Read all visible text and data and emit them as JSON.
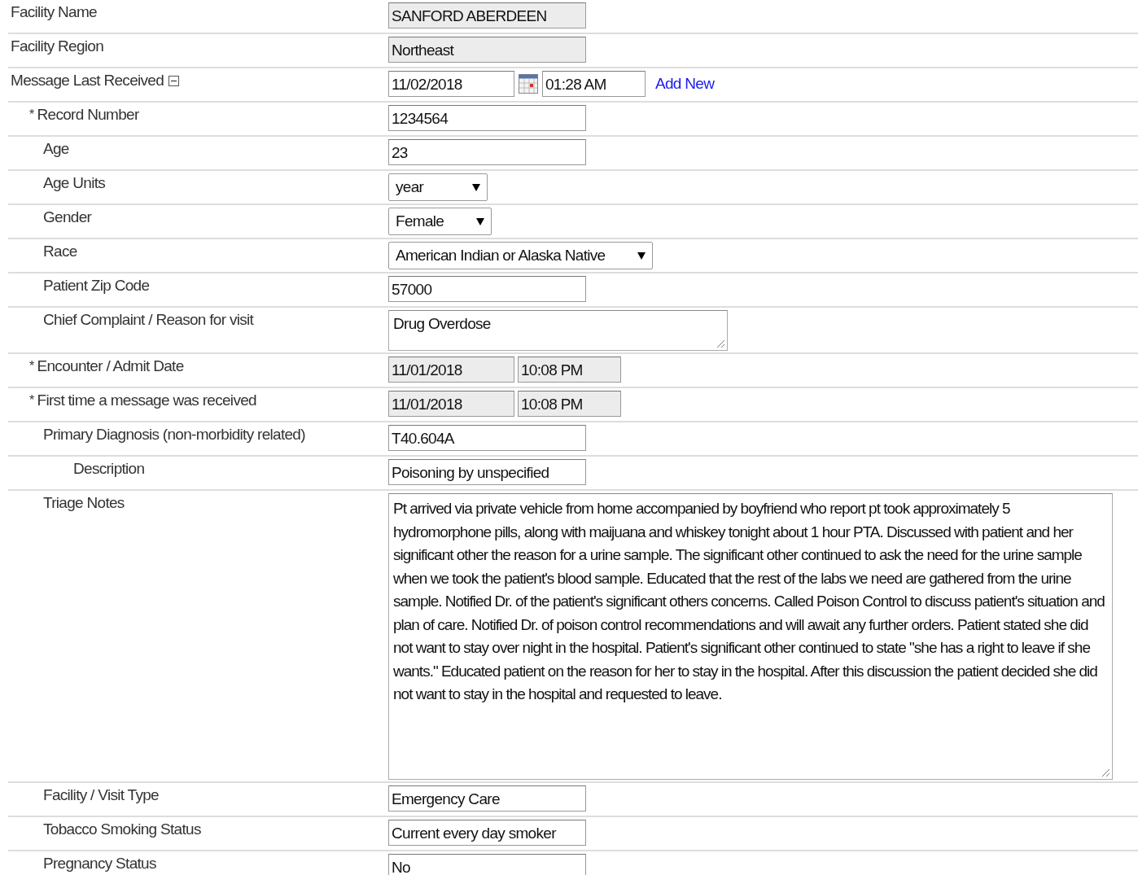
{
  "header_rows": [
    {
      "label": "Facility Name",
      "fields": [
        {
          "kind": "text",
          "value": "SANFORD ABERDEEN",
          "disabled": true
        }
      ]
    },
    {
      "label": "Facility Region",
      "fields": [
        {
          "kind": "text",
          "value": "Northeast",
          "disabled": true
        }
      ]
    },
    {
      "label": "Message Last Received",
      "expanded": true,
      "fields": [
        {
          "kind": "date",
          "value": "11/02/2018",
          "disabled": false
        },
        {
          "kind": "calendar"
        },
        {
          "kind": "time",
          "value": "01:28 AM",
          "disabled": false
        },
        {
          "kind": "link",
          "value": "Add New"
        }
      ]
    }
  ],
  "rows": [
    {
      "marker": "*",
      "label": "Record Number",
      "fields": [
        {
          "kind": "text",
          "value": "1234564",
          "disabled": false
        }
      ]
    },
    {
      "label": "Age",
      "fields": [
        {
          "kind": "text",
          "value": "23",
          "disabled": false
        }
      ]
    },
    {
      "label": "Age Units",
      "fields": [
        {
          "kind": "select",
          "value": "year"
        }
      ]
    },
    {
      "label": "Gender",
      "fields": [
        {
          "kind": "select",
          "value": "Female"
        }
      ]
    },
    {
      "label": "Race",
      "fields": [
        {
          "kind": "select",
          "value": "American Indian or Alaska Native"
        }
      ]
    },
    {
      "label": "Patient Zip Code",
      "fields": [
        {
          "kind": "text",
          "value": "57000",
          "disabled": false
        }
      ]
    },
    {
      "label": "Chief Complaint / Reason for visit",
      "fields": [
        {
          "kind": "textarea",
          "value": "Drug Overdose"
        }
      ]
    },
    {
      "marker": "*",
      "label": "Encounter / Admit Date",
      "fields": [
        {
          "kind": "date",
          "value": "11/01/2018",
          "disabled": true
        },
        {
          "kind": "time",
          "value": "10:08 PM",
          "disabled": true
        }
      ]
    },
    {
      "marker": "*",
      "label": "First time a message was received",
      "fields": [
        {
          "kind": "date",
          "value": "11/01/2018",
          "disabled": true
        },
        {
          "kind": "time",
          "value": "10:08 PM",
          "disabled": true
        }
      ]
    },
    {
      "label": "Primary Diagnosis (non-morbidity related)",
      "fields": [
        {
          "kind": "text",
          "value": "T40.604A",
          "disabled": false
        }
      ],
      "children": [
        {
          "label": "Description",
          "fields": [
            {
              "kind": "text",
              "value": "Poisoning by unspecified",
              "disabled": false
            }
          ]
        }
      ]
    },
    {
      "label": "Triage Notes",
      "fields": [
        {
          "kind": "textarea",
          "value": "Pt arrived via private vehicle from home accompanied by boyfriend who report pt took approximately 5 hydromorphone pills, along with maijuana and whiskey tonight about 1 hour PTA. Discussed with patient and her significant other the reason for a urine sample. The significant other continued to ask the need for the urine sample when we took the patient's blood sample. Educated that the rest of the labs we need are gathered from the urine sample. Notified Dr. of the patient's significant others concerns. Called Poison Control to discuss patient's situation and plan of care. Notified Dr. of poison control recommendations and will await any further orders. Patient stated she did not want to stay over night in the hospital. Patient's significant other continued to state \"she has a right to leave if she wants.\" Educated patient on the reason for her to stay in the hospital. After this discussion the patient decided she did not want to stay in the hospital and requested to leave."
        }
      ]
    },
    {
      "label": "Facility / Visit Type",
      "fields": [
        {
          "kind": "text",
          "value": "Emergency Care",
          "disabled": false
        }
      ]
    },
    {
      "label": "Tobacco Smoking Status",
      "fields": [
        {
          "kind": "text",
          "value": "Current every day smoker",
          "disabled": false
        }
      ]
    },
    {
      "label": "Pregnancy Status",
      "fields": [
        {
          "kind": "text",
          "value": "No",
          "disabled": false
        }
      ]
    }
  ]
}
